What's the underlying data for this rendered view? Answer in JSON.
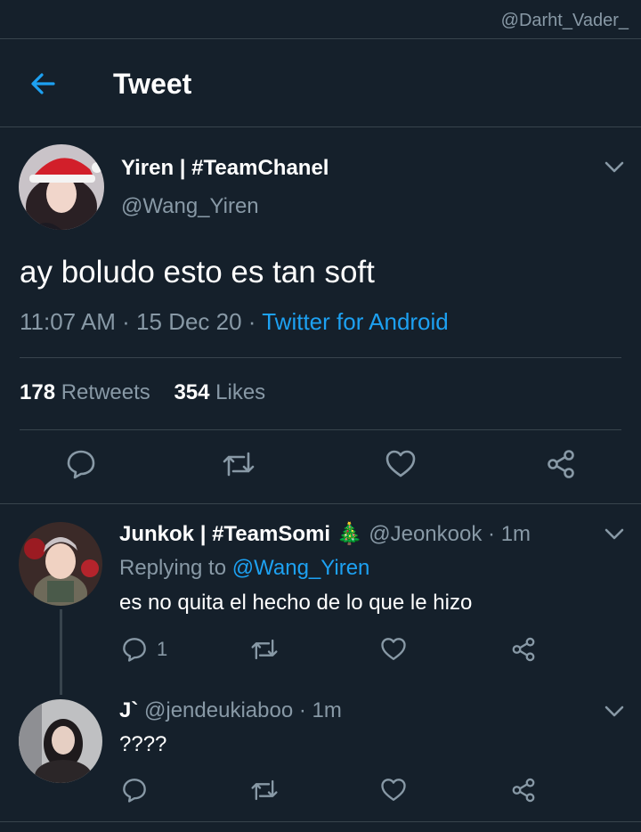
{
  "watermark": "@Darht_Vader_",
  "header": {
    "title": "Tweet"
  },
  "tweet": {
    "name": "Yiren | #TeamChanel",
    "handle": "@Wang_Yiren",
    "text": "ay boludo esto es tan soft",
    "time": "11:07 AM",
    "sep1": " · ",
    "date": "15 Dec 20",
    "sep2": " · ",
    "source": "Twitter for Android",
    "retweets_count": "178",
    "retweets_label": "Retweets",
    "likes_count": "354",
    "likes_label": "Likes"
  },
  "replies": [
    {
      "name": "Junkok | #TeamSomi",
      "emoji": "🎄",
      "handle": "@Jeonkook",
      "sep": " · ",
      "age": "1m",
      "replying_prefix": "Replying to",
      "replying_handle": "@Wang_Yiren",
      "text": "es no quita el hecho de lo que le hizo",
      "reply_count": "1"
    },
    {
      "name": "J`",
      "handle": "@jendeukiaboo",
      "sep": " · ",
      "age": "1m",
      "text": "????"
    }
  ],
  "icons": [
    "back-arrow-icon",
    "chevron-down-icon",
    "reply-icon",
    "retweet-icon",
    "like-icon",
    "share-icon"
  ],
  "colors": {
    "background": "#15202b",
    "accent": "#1da1f2",
    "muted": "#8899a6",
    "divider": "#38444d"
  }
}
